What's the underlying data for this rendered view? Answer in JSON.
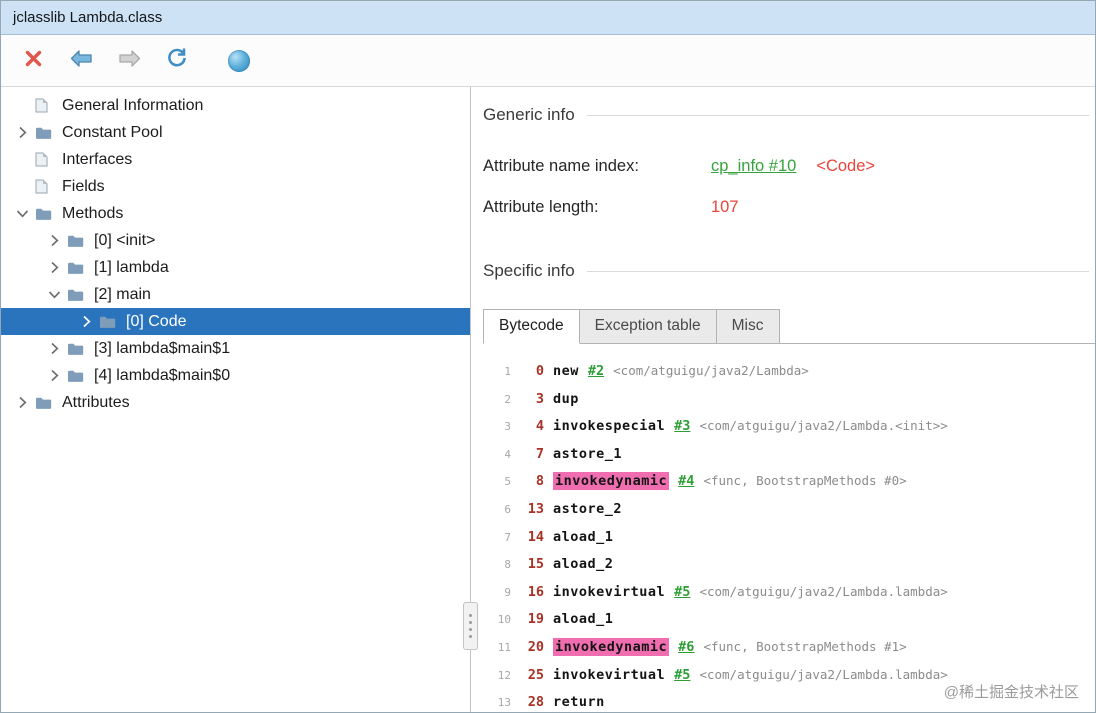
{
  "window": {
    "title": "jclasslib Lambda.class"
  },
  "toolbar": {
    "buttons": [
      {
        "icon": "close-icon"
      },
      {
        "icon": "back-arrow-icon"
      },
      {
        "icon": "forward-arrow-icon"
      },
      {
        "icon": "reload-icon"
      },
      {
        "icon": "browser-sphere-icon"
      }
    ]
  },
  "tree": {
    "items": [
      {
        "label": "General Information",
        "icon": "document",
        "level": 0,
        "chevron": "none",
        "selected": false
      },
      {
        "label": "Constant Pool",
        "icon": "folder",
        "level": 0,
        "chevron": "right",
        "selected": false
      },
      {
        "label": "Interfaces",
        "icon": "document",
        "level": 0,
        "chevron": "none",
        "selected": false
      },
      {
        "label": "Fields",
        "icon": "document",
        "level": 0,
        "chevron": "none",
        "selected": false
      },
      {
        "label": "Methods",
        "icon": "folder",
        "level": 0,
        "chevron": "down",
        "selected": false
      },
      {
        "label": "[0] <init>",
        "icon": "folder",
        "level": 1,
        "chevron": "right",
        "selected": false
      },
      {
        "label": "[1] lambda",
        "icon": "folder",
        "level": 1,
        "chevron": "right",
        "selected": false
      },
      {
        "label": "[2] main",
        "icon": "folder",
        "level": 1,
        "chevron": "down",
        "selected": false
      },
      {
        "label": "[0] Code",
        "icon": "folder",
        "level": 2,
        "chevron": "right",
        "selected": true
      },
      {
        "label": "[3] lambda$main$1",
        "icon": "folder",
        "level": 1,
        "chevron": "right",
        "selected": false
      },
      {
        "label": "[4] lambda$main$0",
        "icon": "folder",
        "level": 1,
        "chevron": "right",
        "selected": false
      },
      {
        "label": "Attributes",
        "icon": "folder",
        "level": 0,
        "chevron": "right",
        "selected": false
      }
    ]
  },
  "detail": {
    "generic_info": {
      "title": "Generic info",
      "rows": [
        {
          "label": "Attribute name index:",
          "link": "cp_info #10",
          "extra": "<Code>"
        },
        {
          "label": "Attribute length:",
          "value": "107"
        }
      ]
    },
    "specific_info": {
      "title": "Specific info",
      "tabs": [
        {
          "label": "Bytecode",
          "active": true
        },
        {
          "label": "Exception table",
          "active": false
        },
        {
          "label": "Misc",
          "active": false
        }
      ]
    },
    "bytecode": {
      "lines": [
        {
          "num": 1,
          "offset": "0",
          "mnemonic": "new",
          "link": "#2",
          "detail": "<com/atguigu/java2/Lambda>",
          "highlight": false
        },
        {
          "num": 2,
          "offset": "3",
          "mnemonic": "dup",
          "link": "",
          "detail": "",
          "highlight": false
        },
        {
          "num": 3,
          "offset": "4",
          "mnemonic": "invokespecial",
          "link": "#3",
          "detail": "<com/atguigu/java2/Lambda.<init>>",
          "highlight": false
        },
        {
          "num": 4,
          "offset": "7",
          "mnemonic": "astore_1",
          "link": "",
          "detail": "",
          "highlight": false
        },
        {
          "num": 5,
          "offset": "8",
          "mnemonic": "invokedynamic",
          "link": "#4",
          "detail": "<func, BootstrapMethods #0>",
          "highlight": true
        },
        {
          "num": 6,
          "offset": "13",
          "mnemonic": "astore_2",
          "link": "",
          "detail": "",
          "highlight": false
        },
        {
          "num": 7,
          "offset": "14",
          "mnemonic": "aload_1",
          "link": "",
          "detail": "",
          "highlight": false
        },
        {
          "num": 8,
          "offset": "15",
          "mnemonic": "aload_2",
          "link": "",
          "detail": "",
          "highlight": false
        },
        {
          "num": 9,
          "offset": "16",
          "mnemonic": "invokevirtual",
          "link": "#5",
          "detail": "<com/atguigu/java2/Lambda.lambda>",
          "highlight": false
        },
        {
          "num": 10,
          "offset": "19",
          "mnemonic": "aload_1",
          "link": "",
          "detail": "",
          "highlight": false
        },
        {
          "num": 11,
          "offset": "20",
          "mnemonic": "invokedynamic",
          "link": "#6",
          "detail": "<func, BootstrapMethods #1>",
          "highlight": true
        },
        {
          "num": 12,
          "offset": "25",
          "mnemonic": "invokevirtual",
          "link": "#5",
          "detail": "<com/atguigu/java2/Lambda.lambda>",
          "highlight": false
        },
        {
          "num": 13,
          "offset": "28",
          "mnemonic": "return",
          "link": "",
          "detail": "",
          "highlight": false
        }
      ]
    },
    "watermark": "@稀土掘金技术社区"
  },
  "colors": {
    "titlebar_blue": "#cde3f5",
    "selection_blue": "#2a74bd",
    "link_green": "#37a33c",
    "value_red": "#e8443c",
    "offset_red": "#a93226",
    "highlight_pink": "#f06eb0"
  }
}
